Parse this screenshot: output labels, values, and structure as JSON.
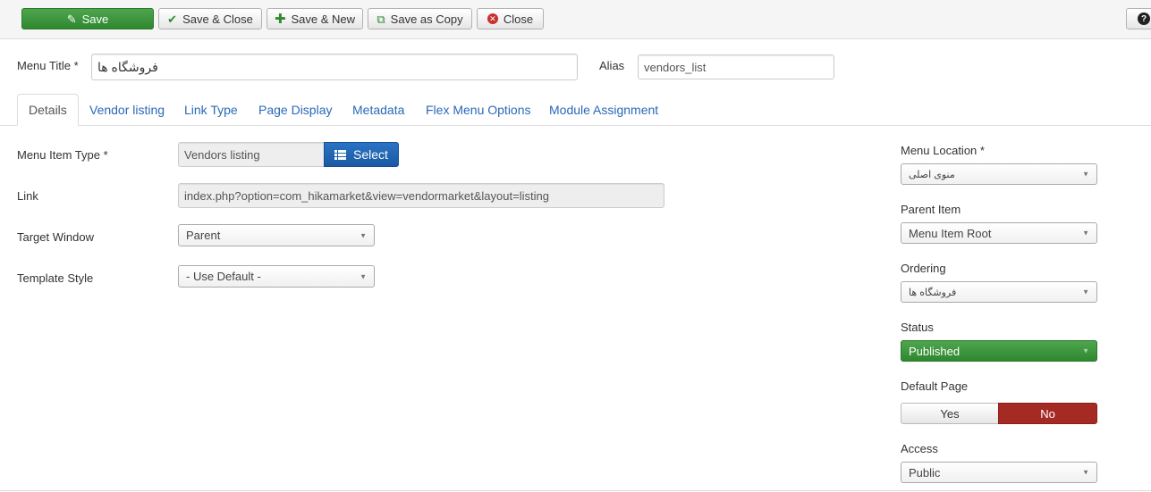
{
  "toolbar": {
    "save": "Save",
    "save_close": "Save & Close",
    "save_new": "Save & New",
    "save_copy": "Save as Copy",
    "close": "Close",
    "help": "?"
  },
  "header": {
    "menu_title_label": "Menu Title *",
    "menu_title_value": "فروشگاه ها",
    "alias_label": "Alias",
    "alias_value": "vendors_list"
  },
  "tabs": [
    {
      "label": "Details",
      "active": true
    },
    {
      "label": "Vendor listing"
    },
    {
      "label": "Link Type"
    },
    {
      "label": "Page Display"
    },
    {
      "label": "Metadata"
    },
    {
      "label": "Flex Menu Options"
    },
    {
      "label": "Module Assignment"
    }
  ],
  "details": {
    "menu_item_type_label": "Menu Item Type *",
    "menu_item_type_value": "Vendors listing",
    "select_button": "Select",
    "link_label": "Link",
    "link_value": "index.php?option=com_hikamarket&view=vendormarket&layout=listing",
    "target_window_label": "Target Window",
    "target_window_value": "Parent",
    "template_style_label": "Template Style",
    "template_style_value": "- Use Default -"
  },
  "sidebar": {
    "menu_location_label": "Menu Location *",
    "menu_location_value": "منوی اصلی",
    "parent_item_label": "Parent Item",
    "parent_item_value": "Menu Item Root",
    "ordering_label": "Ordering",
    "ordering_value": "فروشگاه ها",
    "status_label": "Status",
    "status_value": "Published",
    "default_page_label": "Default Page",
    "default_page_yes": "Yes",
    "default_page_no": "No",
    "access_label": "Access",
    "access_value": "Public"
  },
  "colors": {
    "success": "#3c9a3c",
    "primary": "#1f62ae",
    "danger": "#a52a24",
    "link": "#2a69b8"
  }
}
